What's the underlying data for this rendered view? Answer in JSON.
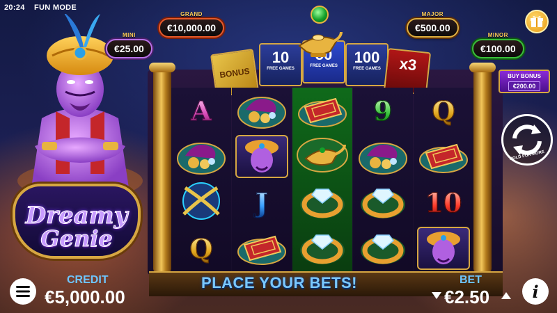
{
  "status": {
    "time": "20:24",
    "mode": "FUN MODE"
  },
  "jackpots": {
    "grand": {
      "label": "GRAND",
      "value": "€10,000.00"
    },
    "major": {
      "label": "MAJOR",
      "value": "€500.00"
    },
    "minor": {
      "label": "MINOR",
      "value": "€100.00"
    },
    "mini": {
      "label": "MINI",
      "value": "€25.00"
    }
  },
  "banners": {
    "bonus": "BONUS",
    "b10": "10",
    "b50": "50",
    "b100": "100",
    "free_games": "FREE GAMES",
    "x3": "x3"
  },
  "logo": {
    "line1": "Dreamy",
    "line2": "Genie"
  },
  "buy_bonus": {
    "label": "BUY BONUS",
    "price": "€200.00"
  },
  "spin": {
    "hold_text": "HOLD FOR MORE"
  },
  "reels": [
    [
      "A",
      "treasure-icon",
      "scimitars-icon",
      "Q"
    ],
    [
      "treasure-icon",
      "genie-card-icon",
      "J",
      "magic-carpet-icon"
    ],
    [
      "magic-carpet-icon",
      "lamp-icon",
      "ring-icon",
      "ring-icon"
    ],
    [
      "9",
      "treasure-icon",
      "ring-icon",
      "ring-icon"
    ],
    [
      "Q",
      "magic-carpet-icon",
      "10",
      "genie-card-icon"
    ]
  ],
  "message": "PLACE YOUR BETS!",
  "credit": {
    "label": "CREDIT",
    "value": "€5,000.00"
  },
  "bet": {
    "label": "BET",
    "value": "€2.50"
  },
  "colors": {
    "accent_gold": "#d6a742",
    "label_blue": "#6ec6ff",
    "minor_green": "#3bbf3b",
    "grand_red": "#e85a2a"
  }
}
